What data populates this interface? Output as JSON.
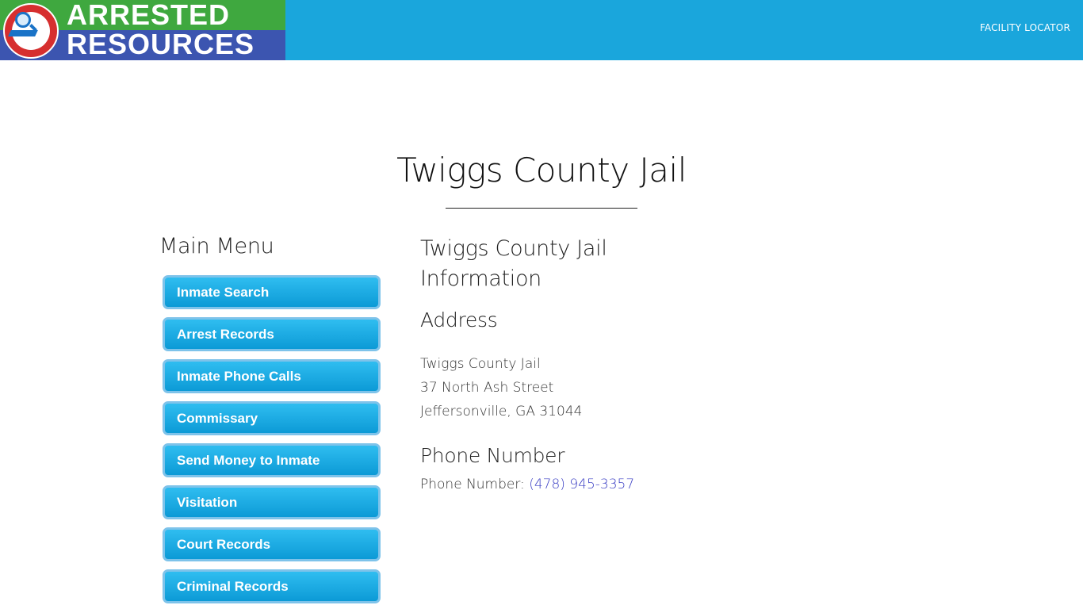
{
  "header": {
    "logo": {
      "line1": "ARRESTED",
      "line2": "RESOURCES",
      "badge_icon": "magnifier-laptop-badge-icon",
      "colors": {
        "top_band": "#3fa83f",
        "bottom_band": "#3c55b0",
        "badge": "#d62f2f"
      }
    },
    "nav": {
      "facility_locator": "FACILITY LOCATOR"
    },
    "bg_color": "#1aa6dc"
  },
  "page": {
    "title": "Twiggs County Jail"
  },
  "sidebar": {
    "title": "Main Menu",
    "items": [
      {
        "label": "Inmate Search"
      },
      {
        "label": "Arrest Records"
      },
      {
        "label": "Inmate Phone Calls"
      },
      {
        "label": "Commissary"
      },
      {
        "label": "Send Money to Inmate"
      },
      {
        "label": "Visitation"
      },
      {
        "label": "Court Records"
      },
      {
        "label": "Criminal Records"
      }
    ],
    "button_color": "#1aa6dc"
  },
  "content": {
    "info_title": "Twiggs County Jail Information",
    "address_heading": "Address",
    "address": {
      "name": "Twiggs County Jail",
      "street": "37 North Ash Street",
      "city_state_zip": "Jeffersonville, GA 31044"
    },
    "phone_heading": "Phone Number",
    "phone_label": "Phone Number:",
    "phone_value": "(478) 945-3357",
    "link_color": "#3b3fc4"
  }
}
